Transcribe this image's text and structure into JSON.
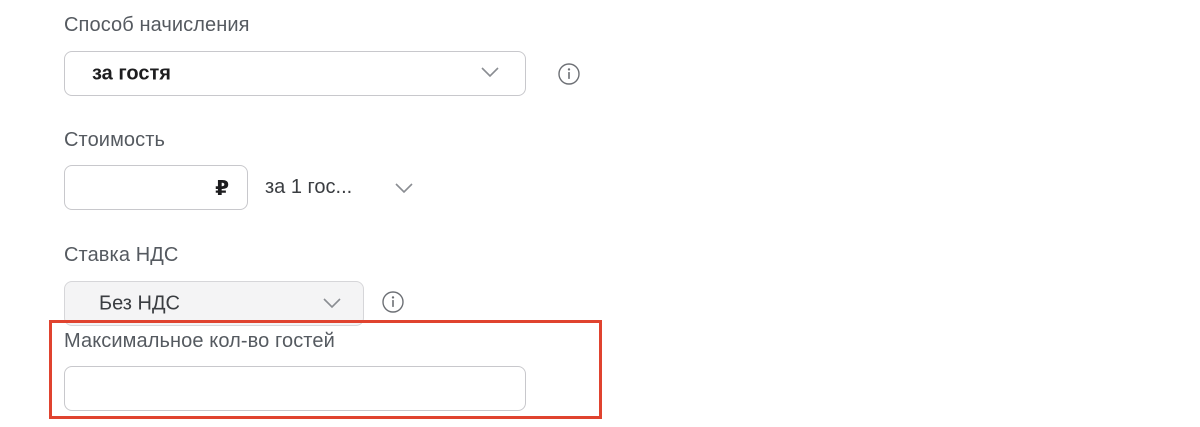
{
  "accrual": {
    "label": "Способ начисления",
    "selected": "за гостя"
  },
  "cost": {
    "label": "Стоимость",
    "value": "",
    "currency_symbol": "₽",
    "unit_selected": "за 1 гос..."
  },
  "vat": {
    "label": "Ставка НДС",
    "selected": "Без НДС"
  },
  "max_guests": {
    "label": "Максимальное кол-во гостей",
    "value": ""
  },
  "icons": {
    "chevron": "chevron-down-icon",
    "info": "info-circle-icon"
  },
  "colors": {
    "highlight": "#e0432f",
    "border": "#c8c8cc",
    "disabled_bg": "#f4f4f5",
    "label_text": "#555a60"
  }
}
